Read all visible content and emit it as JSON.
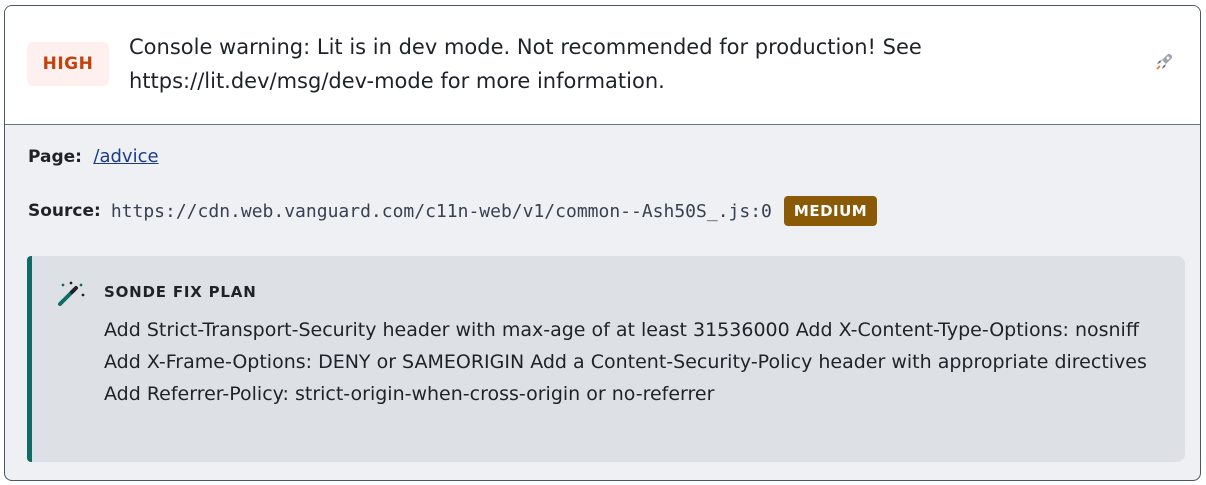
{
  "severity": {
    "label": "HIGH",
    "color": "#c2410c"
  },
  "issue": {
    "title": "Console warning: Lit is in dev mode. Not recommended for production! See https://lit.dev/msg/dev-mode for more information.",
    "action_icon": "rocket-icon"
  },
  "page": {
    "label": "Page:",
    "value": "/advice"
  },
  "source": {
    "label": "Source:",
    "value": "https://cdn.web.vanguard.com/c11n-web/v1/common--Ash50S_.js:0",
    "badge": "MEDIUM",
    "badge_color": "#8a5a06"
  },
  "fix_plan": {
    "icon": "magic-wand-icon",
    "title": "SONDE FIX PLAN",
    "text": "Add Strict-Transport-Security header with max-age of at least 31536000 Add X-Content-Type-Options: nosniff Add X-Frame-Options: DENY or SAMEORIGIN Add a Content-Security-Policy header with appropriate directives Add Referrer-Policy: strict-origin-when-cross-origin or no-referrer",
    "accent_color": "#0f6b63"
  }
}
